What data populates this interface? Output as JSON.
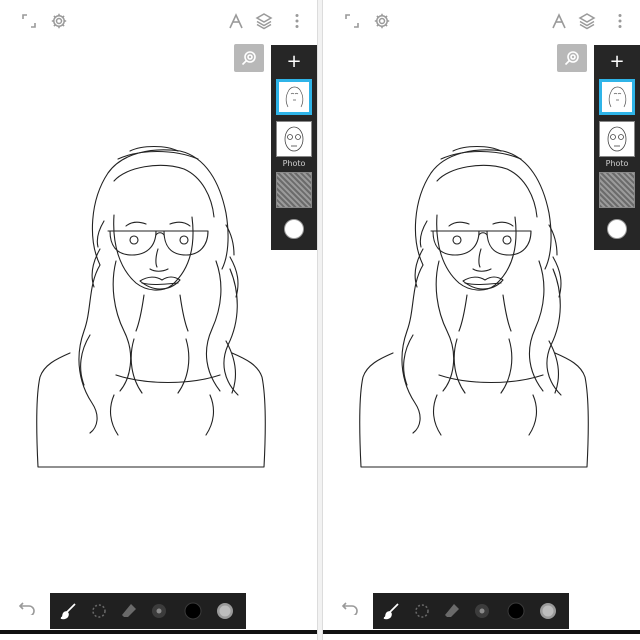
{
  "screens": [
    {
      "id": "left",
      "layers": {
        "add_label": "+",
        "reference_label": "Photo"
      }
    },
    {
      "id": "right",
      "layers": {
        "add_label": "+",
        "reference_label": "Photo"
      }
    }
  ],
  "icons": {
    "fullscreen": "fullscreen-icon",
    "settings": "gear-icon",
    "perspective": "perspective-ruler-icon",
    "layers": "layers-icon",
    "more": "more-vertical-icon",
    "reference": "reference-eye-icon",
    "undo": "undo-icon",
    "brush": "brush-icon",
    "smudge": "smudge-icon",
    "eraser": "eraser-icon",
    "size": "brush-size-icon",
    "color": "color-swatch-icon",
    "opacity": "opacity-icon"
  },
  "colors": {
    "toolbar_bg": "#202020",
    "layers_bg": "#262626",
    "selected_layer_border": "#2fb4e8",
    "current_color": "#000000",
    "reference_button_bg": "#b8b8b8"
  }
}
